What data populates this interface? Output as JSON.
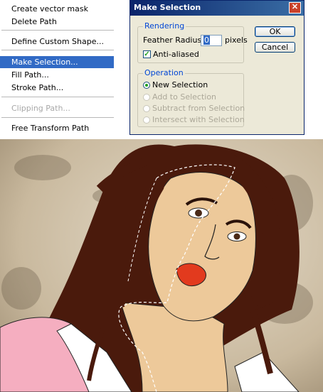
{
  "menu": {
    "items": [
      {
        "label": "Create vector mask",
        "state": "normal"
      },
      {
        "label": "Delete Path",
        "state": "normal"
      },
      {
        "label": "Define Custom Shape...",
        "state": "normal"
      },
      {
        "label": "Make Selection...",
        "state": "highlighted"
      },
      {
        "label": "Fill Path...",
        "state": "normal"
      },
      {
        "label": "Stroke Path...",
        "state": "normal"
      },
      {
        "label": "Clipping Path...",
        "state": "disabled"
      },
      {
        "label": "Free Transform Path",
        "state": "normal"
      }
    ]
  },
  "dialog": {
    "title": "Make Selection",
    "rendering": {
      "legend": "Rendering",
      "feather_label": "Feather Radius:",
      "feather_value": "0",
      "feather_unit": "pixels",
      "antialias_label": "Anti-aliased",
      "antialias_checked": true
    },
    "operation": {
      "legend": "Operation",
      "options": [
        {
          "label": "New Selection",
          "selected": true,
          "enabled": true
        },
        {
          "label": "Add to Selection",
          "selected": false,
          "enabled": false
        },
        {
          "label": "Subtract from Selection",
          "selected": false,
          "enabled": false
        },
        {
          "label": "Intersect with Selection",
          "selected": false,
          "enabled": false
        }
      ]
    },
    "ok_label": "OK",
    "cancel_label": "Cancel",
    "close_glyph": "✕"
  },
  "colors": {
    "highlight": "#316ac5",
    "title_bar": "#0a246a",
    "dialog_bg": "#ece9d8",
    "hair": "#4a1a0c",
    "skin": "#edc99a",
    "lips": "#e23a1e",
    "shirt_pink": "#f5aec0"
  }
}
